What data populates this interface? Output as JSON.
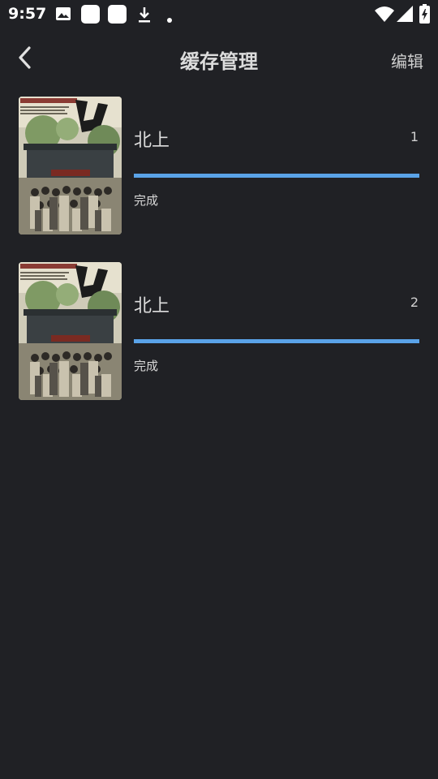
{
  "status_bar": {
    "time": "9:57",
    "icons": [
      "image-icon",
      "app-icon",
      "app-icon",
      "download-icon",
      "dot-icon",
      "wifi-icon",
      "signal-icon",
      "battery-charging-icon"
    ]
  },
  "header": {
    "title": "缓存管理",
    "edit_label": "编辑",
    "back_icon": "chevron-left-icon"
  },
  "items": [
    {
      "title": "北上",
      "count": "1",
      "status": "完成",
      "progress": 1.0
    },
    {
      "title": "北上",
      "count": "2",
      "status": "完成",
      "progress": 1.0
    }
  ],
  "colors": {
    "background": "#202125",
    "accent": "#5aa3e8"
  }
}
